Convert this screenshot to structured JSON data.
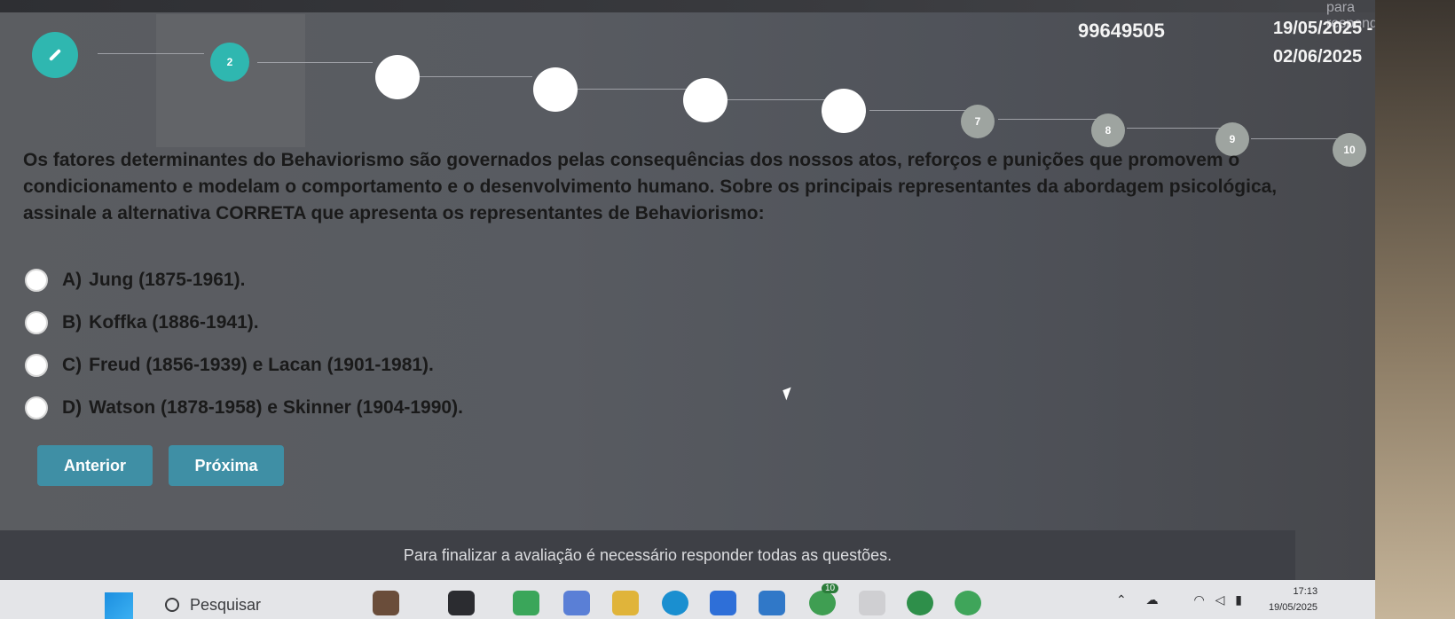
{
  "header": {
    "faded_label": "para responder",
    "exam_id": "99649505",
    "date_start": "19/05/2025 -",
    "date_end": "02/06/2025"
  },
  "stepper": {
    "steps": [
      {
        "label": "",
        "icon": "pencil-icon",
        "state": "done"
      },
      {
        "label": "2",
        "state": "current"
      },
      {
        "label": "",
        "state": "visited"
      },
      {
        "label": "",
        "state": "visited"
      },
      {
        "label": "",
        "state": "visited"
      },
      {
        "label": "",
        "state": "visited"
      },
      {
        "label": "7",
        "state": "todo"
      },
      {
        "label": "8",
        "state": "todo"
      },
      {
        "label": "9",
        "state": "todo"
      },
      {
        "label": "10",
        "state": "todo"
      }
    ]
  },
  "question": {
    "text": "Os fatores determinantes do Behaviorismo são governados pelas consequências dos nossos atos, reforços e punições que promovem o condicionamento e modelam o comportamento e o desenvolvimento humano. Sobre os principais representantes da abordagem psicológica, assinale a alternativa CORRETA que apresenta os representantes de Behaviorismo:"
  },
  "options": [
    {
      "letter": "A)",
      "text": "Jung (1875-1961)."
    },
    {
      "letter": "B)",
      "text": "Koffka (1886-1941)."
    },
    {
      "letter": "C)",
      "text": "Freud (1856-1939) e Lacan (1901-1981)."
    },
    {
      "letter": "D)",
      "text": "Watson (1878-1958) e Skinner (1904-1990)."
    }
  ],
  "nav": {
    "prev_label": "Anterior",
    "next_label": "Próxima"
  },
  "footer": {
    "message": "Para finalizar a avaliação é necessário responder todas as questões."
  },
  "taskbar": {
    "search_placeholder": "Pesquisar",
    "widget_badge": "10",
    "clock_time": "17:13",
    "clock_date": "19/05/2025"
  },
  "colors": {
    "accent_teal": "#2fb7b0",
    "button_blue": "#3f8fa5",
    "footer_bg": "#3e4046"
  }
}
